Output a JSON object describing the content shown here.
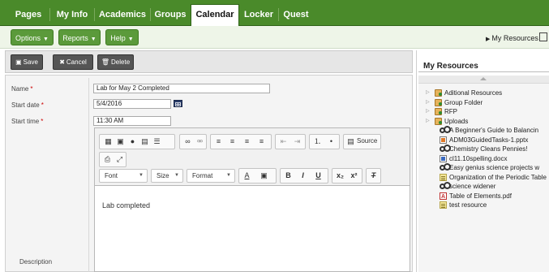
{
  "tabs": [
    "Pages",
    "My Info",
    "Academics",
    "Groups",
    "Calendar",
    "Locker",
    "Quest"
  ],
  "active_tab": "Calendar",
  "menu": {
    "options": "Options",
    "reports": "Reports",
    "help": "Help",
    "my_resources_link": "My Resources"
  },
  "form_toolbar": {
    "save": "Save",
    "cancel": "Cancel",
    "delete": "Delete"
  },
  "form": {
    "name_label": "Name",
    "name_value": "Lab for May 2 Completed",
    "start_date_label": "Start date",
    "start_date_value": "5/4/2016",
    "start_time_label": "Start time",
    "start_time_value": "11:30 AM",
    "description_label": "Description",
    "required_mark": "*"
  },
  "editor": {
    "source_label": "Source",
    "font_label": "Font",
    "size_label": "Size",
    "format_label": "Format",
    "content": "Lab completed"
  },
  "resources": {
    "title": "My Resources",
    "items": [
      {
        "label": "Aditional Resources",
        "icon": "folder-icon",
        "expandable": true
      },
      {
        "label": "Group Folder",
        "icon": "folder-icon",
        "expandable": true
      },
      {
        "label": "RFP",
        "icon": "folder-icon",
        "expandable": true
      },
      {
        "label": "Uploads",
        "icon": "folder-icon",
        "expandable": true
      },
      {
        "label": "A Beginner's Guide to Balancin",
        "icon": "link-icon",
        "expandable": false
      },
      {
        "label": "ADM03GuidedTasks-1.pptx",
        "icon": "pptx-file-icon",
        "expandable": false
      },
      {
        "label": "Chemistry Cleans Pennies!",
        "icon": "link-icon",
        "expandable": false
      },
      {
        "label": "cl11.10spelling.docx",
        "icon": "docx-file-icon",
        "expandable": false
      },
      {
        "label": "Easy genius science projects w",
        "icon": "link-icon",
        "expandable": false
      },
      {
        "label": "Organization of the Periodic Table",
        "icon": "note-icon",
        "expandable": false
      },
      {
        "label": "science widener",
        "icon": "link-icon",
        "expandable": false
      },
      {
        "label": "Table of Elements.pdf",
        "icon": "pdf-file-icon",
        "expandable": false
      },
      {
        "label": "test resource",
        "icon": "note-icon",
        "expandable": false
      }
    ]
  },
  "colors": {
    "tabbar": "#4a8a2a",
    "menubutton": "#5b9a3b",
    "formbutton": "#555555"
  }
}
